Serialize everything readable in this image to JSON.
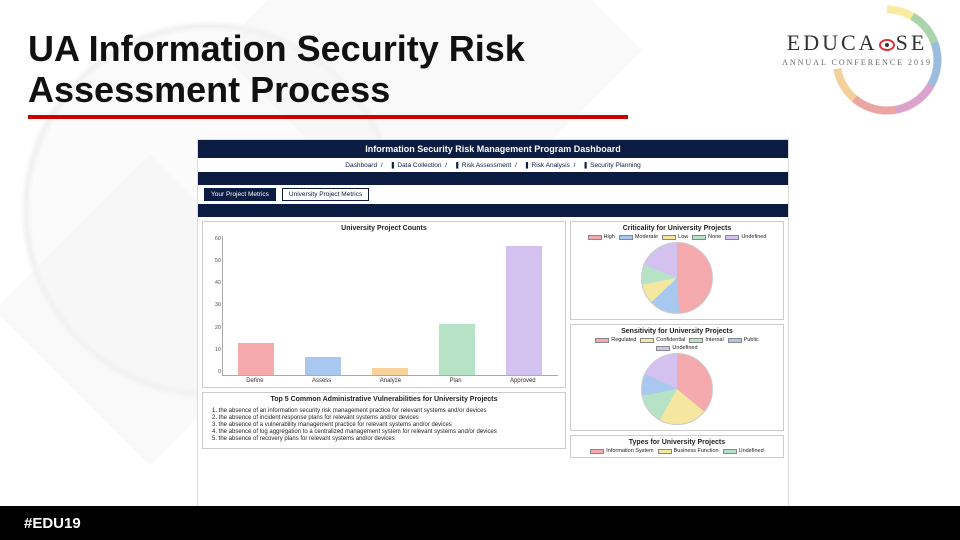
{
  "slide": {
    "title": "UA Information Security Risk Assessment Process",
    "footer": "#EDU19",
    "logo_main": "EDUCAUSE",
    "logo_sub": "ANNUAL CONFERENCE 2019"
  },
  "dashboard": {
    "header": "Information Security Risk Management Program Dashboard",
    "breadcrumb": [
      "Dashboard",
      "❚ Data Collection",
      "❚ Risk Assessment",
      "❚ Risk Analysis",
      "❚ Security Planning"
    ],
    "tabs": {
      "active": "Your Project Metrics",
      "other": "University Project Metrics"
    }
  },
  "chart_data": [
    {
      "type": "bar",
      "title": "University Project Counts",
      "categories": [
        "Define",
        "Assess",
        "Analyze",
        "Plan",
        "Approved"
      ],
      "values": [
        14,
        8,
        3,
        22,
        56
      ],
      "ylim": [
        0,
        60
      ],
      "yticks": [
        60,
        50,
        40,
        30,
        20,
        10,
        0
      ],
      "colors": [
        "#f4a9ad",
        "#a9c8ef",
        "#f7d39b",
        "#b6e3c5",
        "#d3c1f0"
      ]
    },
    {
      "type": "pie",
      "title": "Criticality for University Projects",
      "series": [
        {
          "name": "High",
          "value": 49,
          "color": "#f4a9ad"
        },
        {
          "name": "Moderate",
          "value": 14,
          "color": "#a9c8ef"
        },
        {
          "name": "Low",
          "value": 9,
          "color": "#f5e6a0"
        },
        {
          "name": "None",
          "value": 9,
          "color": "#b6e3c5"
        },
        {
          "name": "Undefined",
          "value": 19,
          "color": "#d3c1f0"
        }
      ]
    },
    {
      "type": "pie",
      "title": "Sensitivity for University Projects",
      "series": [
        {
          "name": "Regulated",
          "value": 36,
          "color": "#f4a9ad"
        },
        {
          "name": "Confidential",
          "value": 22,
          "color": "#f5e6a0"
        },
        {
          "name": "Internal",
          "value": 14,
          "color": "#b6e3c5"
        },
        {
          "name": "Public",
          "value": 10,
          "color": "#a9c8ef"
        },
        {
          "name": "Undefined",
          "value": 18,
          "color": "#d3c1f0"
        }
      ]
    },
    {
      "type": "legend-only",
      "title": "Types for University Projects",
      "series": [
        {
          "name": "Information System",
          "color": "#f4a9ad"
        },
        {
          "name": "Business Function",
          "color": "#f5e6a0"
        },
        {
          "name": "Undefined",
          "color": "#b6e3c5"
        }
      ]
    }
  ],
  "vuln": {
    "title": "Top 5 Common Administrative Vulnerabilities for University Projects",
    "items": [
      "the absence of an information security risk management practice for relevant systems and/or devices",
      "the absence of incident response plans for relevant systems and/or devices",
      "the absence of a vulnerability management practice for relevant systems and/or devices",
      "the absence of log aggregation to a centralized management system for relevant systems and/or devices",
      "the absence of recovery plans for relevant systems and/or devices"
    ]
  }
}
